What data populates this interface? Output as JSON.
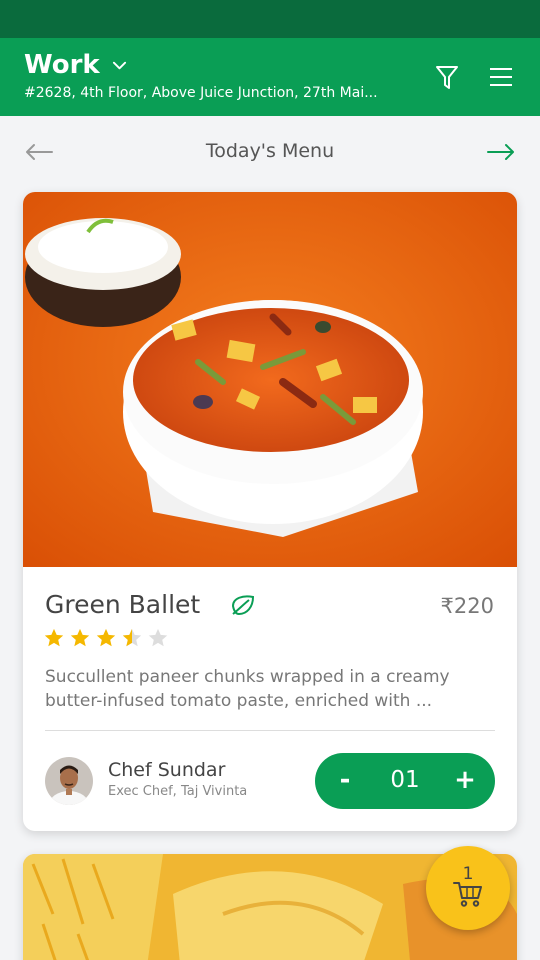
{
  "location": {
    "label": "Work",
    "address": "#2628, 4th Floor, Above Juice Junction, 27th Mai..."
  },
  "menu_header": {
    "title": "Today's Menu"
  },
  "dish": {
    "name": "Green Ballet",
    "price": "₹220",
    "rating": 3.5,
    "rating_max": 5,
    "description": "Succullent paneer chunks wrapped in a creamy butter-infused tomato paste, enriched with ...",
    "quantity": "01",
    "minus_label": "-",
    "plus_label": "+"
  },
  "chef": {
    "name": "Chef Sundar",
    "title": "Exec Chef, Taj Vivinta"
  },
  "cart": {
    "count": "1"
  },
  "icons": {
    "location_dropdown": "chevron-down-icon",
    "filter": "filter-icon",
    "menu": "hamburger-icon",
    "prev": "arrow-left-icon",
    "next": "arrow-right-icon",
    "veg": "leaf-icon",
    "cart": "cart-icon"
  },
  "colors": {
    "primary": "#0a9e55",
    "status_bar": "#0a6b3d",
    "accent": "#f9c21a",
    "star": "#f5b800",
    "star_empty": "#dddddd"
  }
}
